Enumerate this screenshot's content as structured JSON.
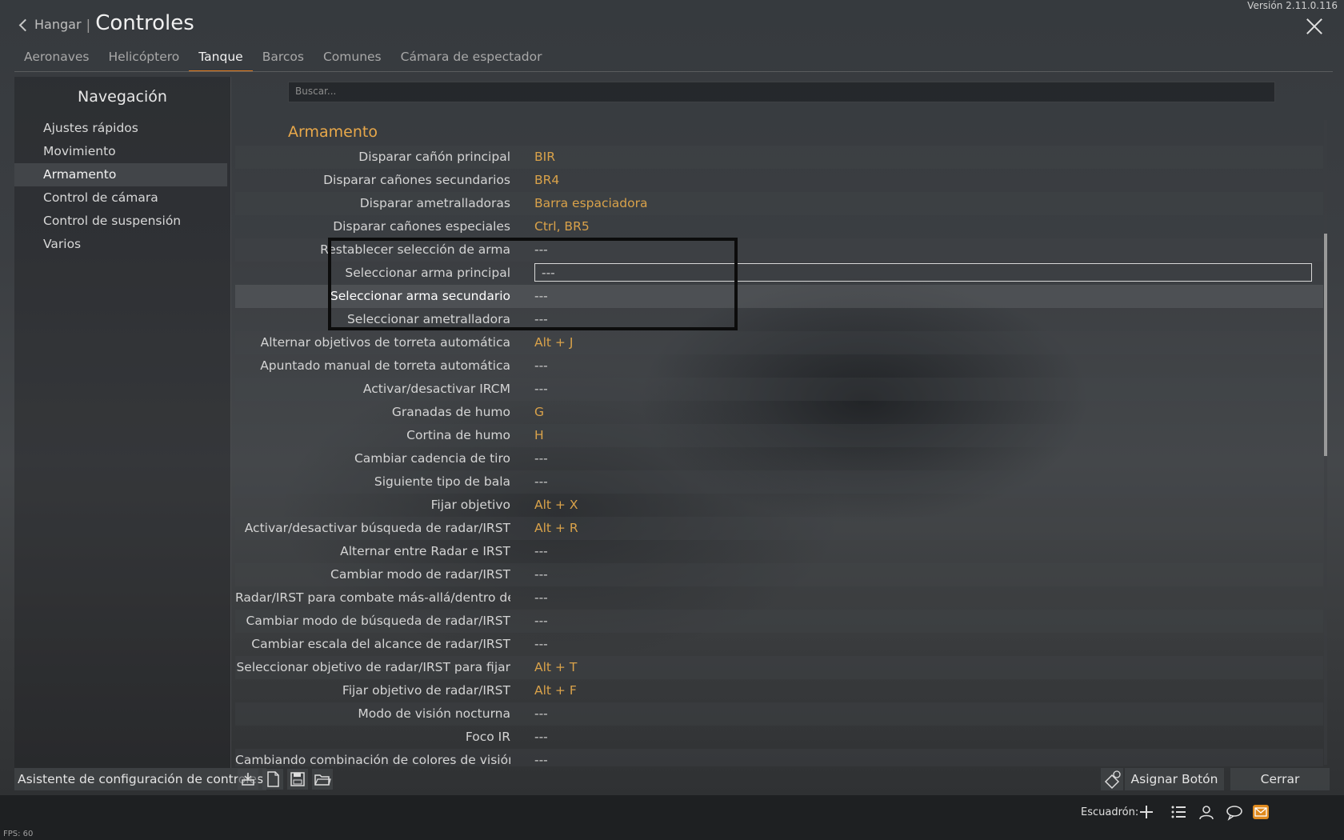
{
  "version": "Versión 2.11.0.116",
  "header": {
    "back_label": "Hangar",
    "separator": "|",
    "title": "Controles"
  },
  "tabs": [
    "Aeronaves",
    "Helicóptero",
    "Tanque",
    "Barcos",
    "Comunes",
    "Cámara de espectador"
  ],
  "active_tab": "Tanque",
  "sidebar": {
    "title": "Navegación",
    "items": [
      "Ajustes rápidos",
      "Movimiento",
      "Armamento",
      "Control de cámara",
      "Control de suspensión",
      "Varios"
    ],
    "active": "Armamento"
  },
  "search": {
    "placeholder": "Buscar..."
  },
  "section": {
    "title": "Armamento"
  },
  "rows": [
    {
      "label": "Disparar cañón principal",
      "value": "BIR"
    },
    {
      "label": "Disparar cañones secundarios",
      "value": "BR4"
    },
    {
      "label": "Disparar ametralladoras",
      "value": "Barra espaciadora"
    },
    {
      "label": "Disparar cañones especiales",
      "value": "Ctrl, BR5"
    },
    {
      "label": "Restablecer selección de arma",
      "value": "---"
    },
    {
      "label": "Seleccionar arma principal",
      "value": "---"
    },
    {
      "label": "Seleccionar arma secundario",
      "value": "---"
    },
    {
      "label": "Seleccionar ametralladora",
      "value": "---"
    },
    {
      "label": "Alternar objetivos de torreta automática",
      "value": "Alt + J"
    },
    {
      "label": "Apuntado manual de torreta automática",
      "value": "---"
    },
    {
      "label": "Activar/desactivar IRCM",
      "value": "---"
    },
    {
      "label": "Granadas de humo",
      "value": "G"
    },
    {
      "label": "Cortina de humo",
      "value": "H"
    },
    {
      "label": "Cambiar cadencia de tiro",
      "value": "---"
    },
    {
      "label": "Siguiente tipo de bala",
      "value": "---"
    },
    {
      "label": "Fijar objetivo",
      "value": "Alt + X"
    },
    {
      "label": "Activar/desactivar búsqueda de radar/IRST",
      "value": "Alt + R"
    },
    {
      "label": "Alternar entre Radar e IRST",
      "value": "---"
    },
    {
      "label": "Cambiar modo de radar/IRST",
      "value": "---"
    },
    {
      "label": "Radar/IRST para combate más-allá/dentro del alcan",
      "value": "---"
    },
    {
      "label": "Cambiar modo de búsqueda de radar/IRST",
      "value": "---"
    },
    {
      "label": "Cambiar escala del alcance de radar/IRST",
      "value": "---"
    },
    {
      "label": "Seleccionar objetivo de radar/IRST para fijar",
      "value": "Alt + T"
    },
    {
      "label": "Fijar objetivo de radar/IRST",
      "value": "Alt + F"
    },
    {
      "label": "Modo de visión nocturna",
      "value": "---"
    },
    {
      "label": "Foco IR",
      "value": "---"
    },
    {
      "label": "Cambiando combinación de colores de visión térmi",
      "value": "---"
    }
  ],
  "bottom": {
    "wizard_label": "Asistente de configuración de controles",
    "assign_label": "Asignar Botón",
    "close_label": "Cerrar"
  },
  "footer": {
    "fps": "FPS: 60",
    "squad_label": "Escuadrón:"
  },
  "colors": {
    "accent": "#e07a1f",
    "value": "#d9a24a",
    "section": "#e8a84a"
  }
}
